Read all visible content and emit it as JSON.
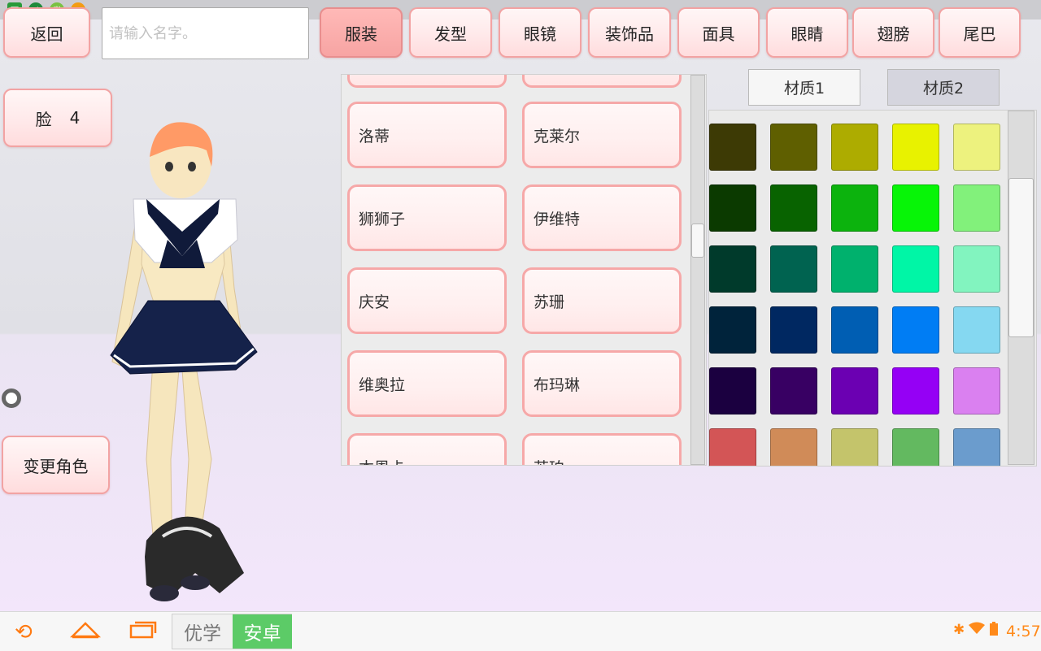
{
  "top_bar": {
    "back_label": "返回",
    "name_placeholder": "请输入名字。",
    "name_value": "",
    "tabs": [
      {
        "label": "服装",
        "active": true
      },
      {
        "label": "发型",
        "active": false
      },
      {
        "label": "眼镜",
        "active": false
      },
      {
        "label": "装饰品",
        "active": false
      },
      {
        "label": "面具",
        "active": false
      },
      {
        "label": "眼睛",
        "active": false
      },
      {
        "label": "翅膀",
        "active": false
      },
      {
        "label": "尾巴",
        "active": false
      }
    ]
  },
  "left_panel": {
    "face_label": "脸",
    "face_value": "4",
    "change_character_label": "变更角色"
  },
  "outfit_list": {
    "items": [
      {
        "label": "洛蒂"
      },
      {
        "label": "克莱尔"
      },
      {
        "label": "狮狮子"
      },
      {
        "label": "伊维特"
      },
      {
        "label": "庆安"
      },
      {
        "label": "苏珊"
      },
      {
        "label": "维奥拉"
      },
      {
        "label": "布玛琳"
      },
      {
        "label": "本恩卡"
      },
      {
        "label": "苏珀"
      }
    ]
  },
  "material": {
    "tabs": [
      {
        "label": "材质1",
        "active": true
      },
      {
        "label": "材质2",
        "active": false
      }
    ],
    "swatches": [
      [
        "#3d3a05",
        "#5f5f00",
        "#adac00",
        "#e8f200",
        "#edf27e"
      ],
      [
        "#0b3a00",
        "#086300",
        "#0cb30d",
        "#07f507",
        "#82f17b"
      ],
      [
        "#003a2b",
        "#006350",
        "#00b16d",
        "#00f6a6",
        "#82f4bf"
      ],
      [
        "#00233b",
        "#002861",
        "#005eb3",
        "#007df4",
        "#85d8f1"
      ],
      [
        "#1b0040",
        "#380063",
        "#6b00b2",
        "#9500f5",
        "#da80f0"
      ],
      [
        "#d35556",
        "#d08b58",
        "#c4c46b",
        "#63b960",
        "#6b9ccd"
      ]
    ]
  },
  "taskbar": {
    "brand_part1": "优学",
    "brand_part2": "安卓",
    "time": "4:57"
  },
  "colors": {
    "button_fill": "#ffe9ea",
    "button_border": "#f2a3a3",
    "active_tab": "#f7a4a3",
    "brand_green": "#5ccb67",
    "nav_orange": "#ff7a12"
  }
}
